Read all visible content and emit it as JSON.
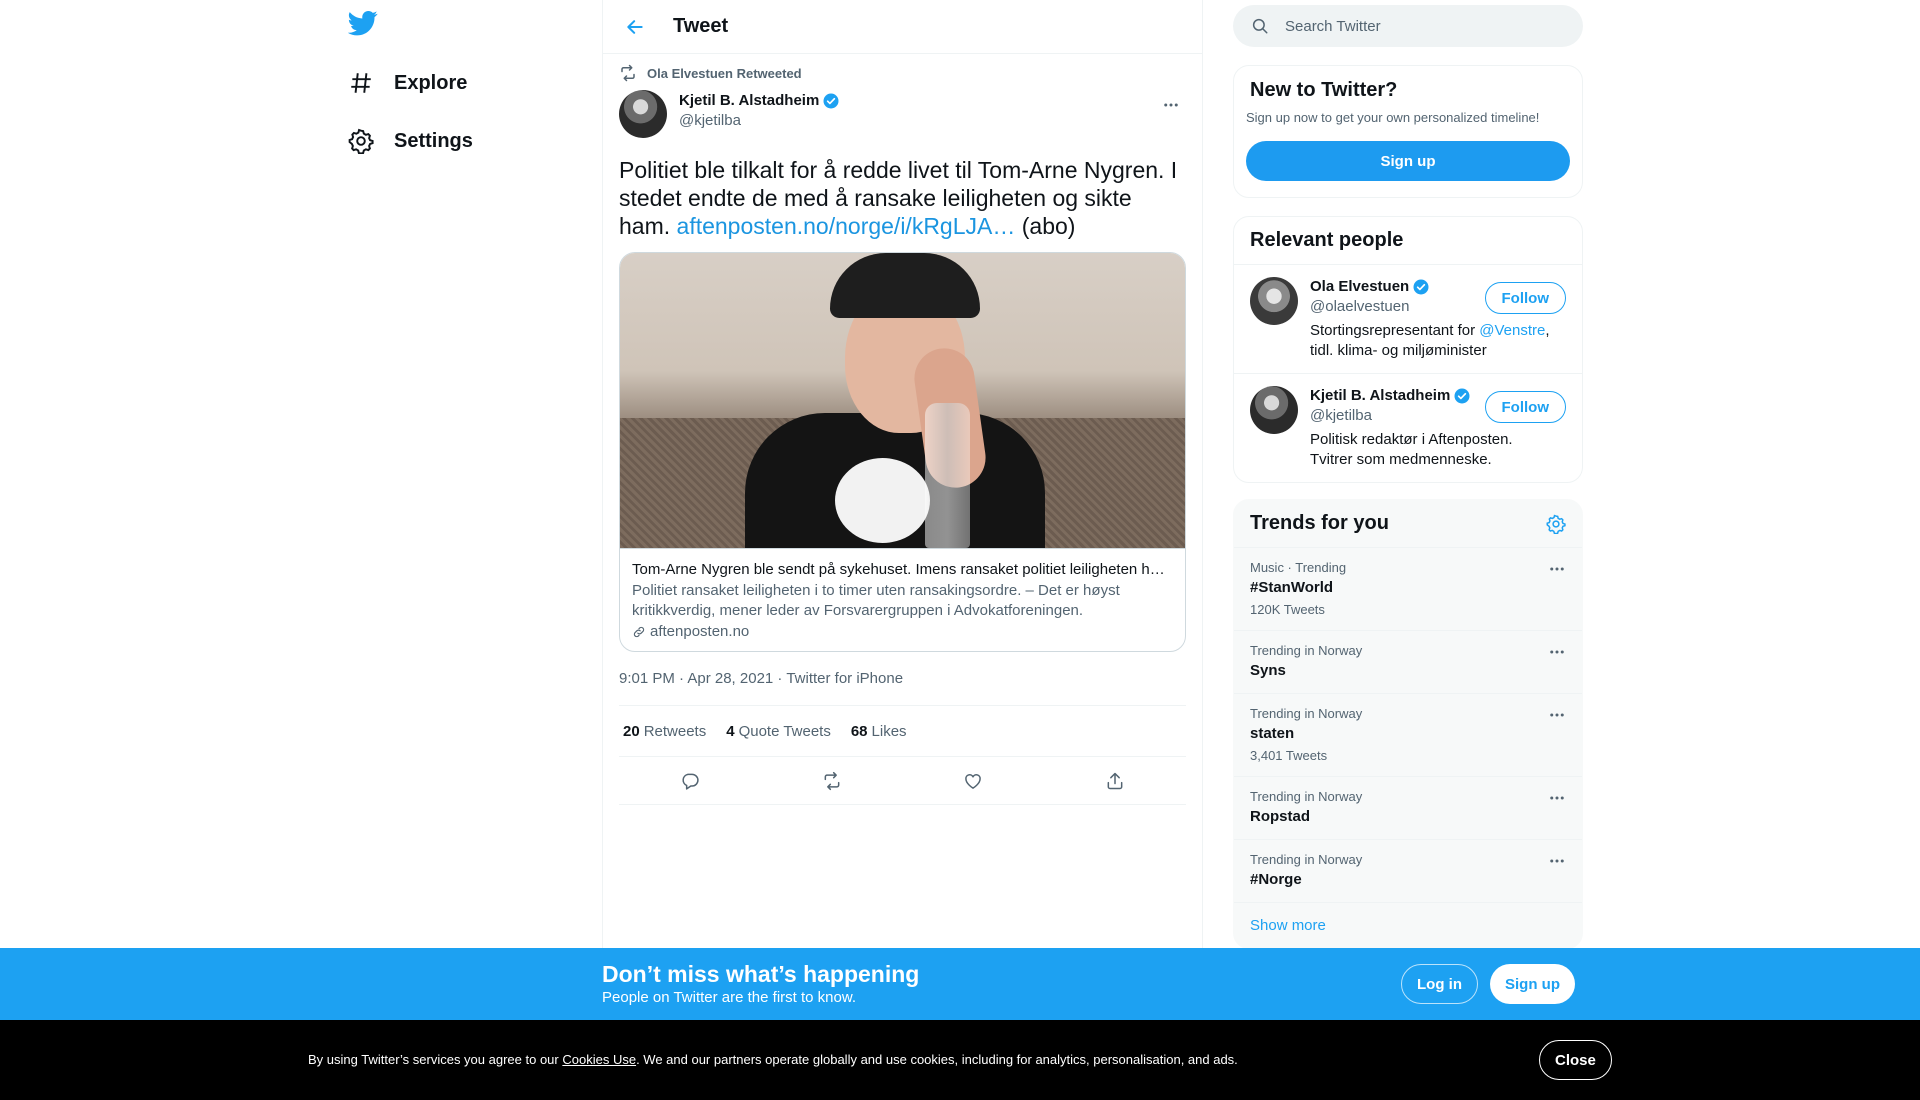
{
  "nav": {
    "logo_icon": "twitter-bird-icon",
    "explore": {
      "label": "Explore",
      "icon": "hashtag-icon"
    },
    "settings": {
      "label": "Settings",
      "icon": "gear-icon"
    }
  },
  "header": {
    "title": "Tweet",
    "back_icon": "arrow-left-icon"
  },
  "tweet": {
    "retweeted_by": "Ola Elvestuen Retweeted",
    "author": {
      "name": "Kjetil B. Alstadheim",
      "handle": "@kjetilba",
      "verified": true
    },
    "text_before": "Politiet ble tilkalt for å redde livet til Tom-Arne Nygren. I stedet endte de med å ransake leiligheten og sikte ham. ",
    "text_link": "aftenposten.no/norge/i/kRgLJA…",
    "text_after": " (abo)",
    "card": {
      "title": "Tom-Arne Nygren ble sendt på sykehuset. Imens ransaket politiet leiligheten h…",
      "description": "Politiet ransaket leiligheten i to timer uten ransakingsordre. – Det er høyst kritikkverdig, mener leder av Forsvarergruppen i Advokatforeningen.",
      "domain": "aftenposten.no"
    },
    "timestamp": "9:01 PM · Apr 28, 2021 · Twitter for iPhone",
    "stats": {
      "retweets_count": "20",
      "retweets_label": "Retweets",
      "quotes_count": "4",
      "quotes_label": "Quote Tweets",
      "likes_count": "68",
      "likes_label": "Likes"
    }
  },
  "search": {
    "placeholder": "Search Twitter"
  },
  "new_to_twitter": {
    "title": "New to Twitter?",
    "subtitle": "Sign up now to get your own personalized timeline!",
    "button": "Sign up"
  },
  "relevant_people": {
    "title": "Relevant people",
    "people": [
      {
        "name": "Ola Elvestuen",
        "handle": "@olaelvestuen",
        "bio_before": "Stortingsrepresentant for ",
        "bio_link": "@Venstre",
        "bio_after": ", tidl. klima- og miljøminister",
        "follow": "Follow"
      },
      {
        "name": "Kjetil B. Alstadheim",
        "handle": "@kjetilba",
        "bio_before": "Politisk redaktør i Aftenposten. Tvitrer som medmenneske.",
        "bio_link": "",
        "bio_after": "",
        "follow": "Follow"
      }
    ]
  },
  "trends": {
    "title": "Trends for you",
    "items": [
      {
        "meta": "Music · Trending",
        "name": "#StanWorld",
        "count": "120K Tweets"
      },
      {
        "meta": "Trending in Norway",
        "name": "Syns",
        "count": ""
      },
      {
        "meta": "Trending in Norway",
        "name": "staten",
        "count": "3,401 Tweets"
      },
      {
        "meta": "Trending in Norway",
        "name": "Ropstad",
        "count": ""
      },
      {
        "meta": "Trending in Norway",
        "name": "#Norge",
        "count": ""
      }
    ],
    "show_more": "Show more"
  },
  "bottom_bar": {
    "title": "Don’t miss what’s happening",
    "subtitle": "People on Twitter are the first to know.",
    "login": "Log in",
    "signup": "Sign up"
  },
  "cookie_bar": {
    "text_before": "By using Twitter’s services you agree to our ",
    "link": "Cookies Use",
    "text_after": ". We and our partners operate globally and use cookies, including for analytics, personalisation, and ads.",
    "close": "Close"
  },
  "colors": {
    "brand": "#1da1f2",
    "text": "#0f1419",
    "muted": "#536471"
  }
}
